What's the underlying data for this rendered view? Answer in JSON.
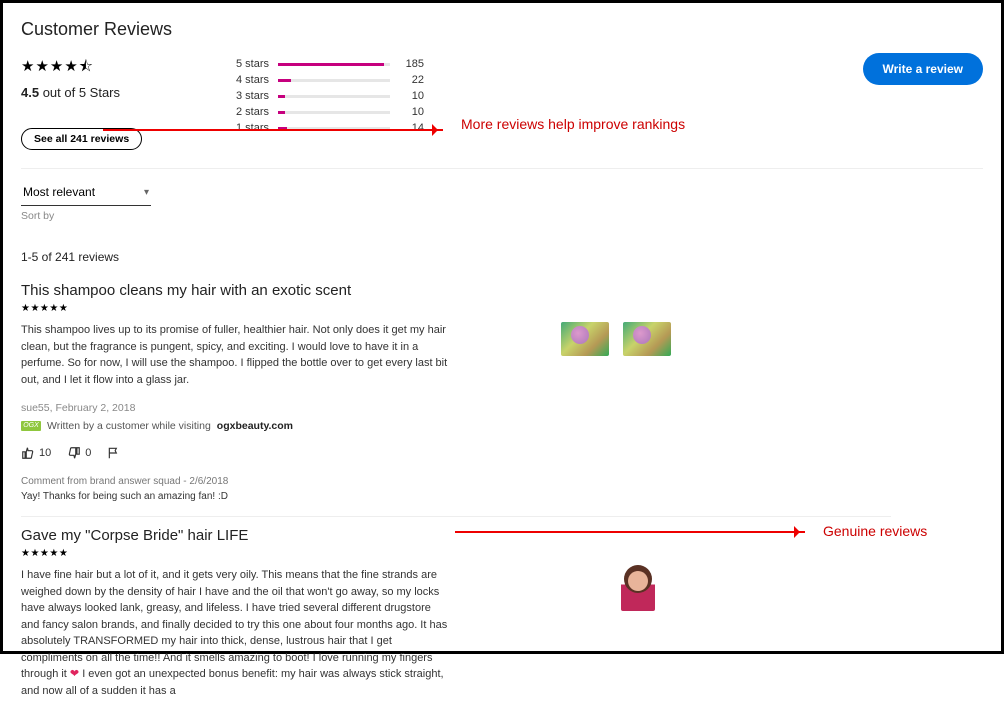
{
  "section_title": "Customer Reviews",
  "rating": {
    "value": "4.5",
    "out_of": " out of 5 Stars",
    "stars_glyph": "★★★★⯪"
  },
  "see_all_label": "See all 241 reviews",
  "histogram": [
    {
      "label": "5 stars",
      "count": "185",
      "pct": 95
    },
    {
      "label": "4 stars",
      "count": "22",
      "pct": 12
    },
    {
      "label": "3 stars",
      "count": "10",
      "pct": 6
    },
    {
      "label": "2 stars",
      "count": "10",
      "pct": 6
    },
    {
      "label": "1 stars",
      "count": "14",
      "pct": 8
    }
  ],
  "write_review_label": "Write a review",
  "sort": {
    "selected": "Most relevant",
    "label": "Sort by"
  },
  "range_text": "1-5 of 241 reviews",
  "reviews": [
    {
      "title": "This shampoo cleans my hair with an exotic scent",
      "stars": "★★★★★",
      "body": "This shampoo lives up to its promise of fuller, healthier hair. Not only does it get my hair clean, but the fragrance is pungent, spicy, and exciting. I would love to have it in a perfume. So for now, I will use the shampoo. I flipped the bottle over to get every last bit out, and I let it flow into a glass jar.",
      "author": "sue55",
      "date": "February 2, 2018",
      "partner_prefix": "Written by a customer while visiting ",
      "partner_site": "ogxbeauty.com",
      "up": "10",
      "down": "0",
      "comment_meta": "Comment from brand answer squad - 2/6/2018",
      "comment_body": "Yay! Thanks for being such an amazing fan! :D"
    },
    {
      "title": "Gave my \"Corpse Bride\" hair LIFE",
      "stars": "★★★★★",
      "body_pre": "I have fine hair but a lot of it, and it gets very oily. This means that the fine strands are weighed down by the density of hair I have and the oil that won't go away, so my locks have always looked lank, greasy, and lifeless.  I have tried several different drugstore and fancy salon brands, and finally decided to try this one about four months ago.  It has absolutely TRANSFORMED my hair into thick, dense, lustrous hair that I get compliments on all the time!! And it smells amazing to boot! I love running my fingers through it ",
      "body_post": " I even got an unexpected bonus benefit: my hair was always stick straight, and now all of a sudden it has a"
    }
  ],
  "annotations": {
    "more_reviews": "More reviews help improve rankings",
    "genuine": "Genuine reviews"
  }
}
